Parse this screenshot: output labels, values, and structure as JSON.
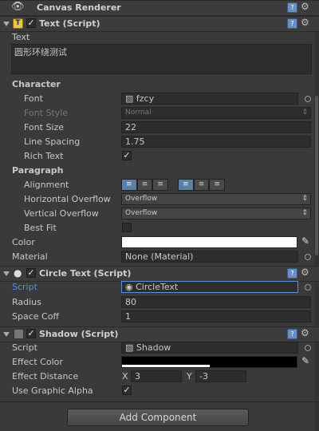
{
  "canvas_renderer": {
    "title": "Canvas Renderer"
  },
  "text_script": {
    "title": "Text (Script)",
    "text_label": "Text",
    "text_value": "圆形环绕测试",
    "character_heading": "Character",
    "font_label": "Font",
    "font_value": "fzcy",
    "font_style_label": "Font Style",
    "font_style_value": "Normal",
    "font_size_label": "Font Size",
    "font_size_value": "22",
    "line_spacing_label": "Line Spacing",
    "line_spacing_value": "1.75",
    "rich_text_label": "Rich Text",
    "paragraph_heading": "Paragraph",
    "alignment_label": "Alignment",
    "horizontal_overflow_label": "Horizontal Overflow",
    "horizontal_overflow_value": "Overflow",
    "vertical_overflow_label": "Vertical Overflow",
    "vertical_overflow_value": "Overflow",
    "best_fit_label": "Best Fit",
    "color_label": "Color",
    "material_label": "Material",
    "material_value": "None (Material)"
  },
  "circle_text": {
    "title": "Circle Text (Script)",
    "script_label": "Script",
    "script_value": "CircleText",
    "radius_label": "Radius",
    "radius_value": "80",
    "space_coff_label": "Space Coff",
    "space_coff_value": "1"
  },
  "shadow": {
    "title": "Shadow (Script)",
    "script_label": "Script",
    "script_value": "Shadow",
    "effect_color_label": "Effect Color",
    "effect_distance_label": "Effect Distance",
    "x_label": "X",
    "x_value": "3",
    "y_label": "Y",
    "y_value": "-3",
    "use_graphic_alpha_label": "Use Graphic Alpha"
  },
  "add_component_label": "Add Component",
  "colors": {
    "accent_blue": "#5b8fd6",
    "header_bg": "#3c3c3c",
    "field_bg": "#2d2d2d"
  }
}
